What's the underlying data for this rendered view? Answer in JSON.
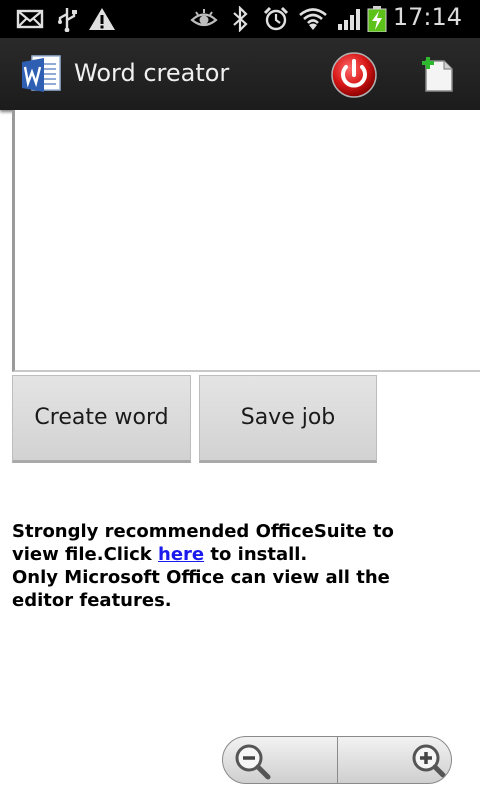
{
  "status_bar": {
    "time": "17:14",
    "icons": [
      "mail-icon",
      "usb-icon",
      "warning-icon",
      "eye-icon",
      "bluetooth-icon",
      "alarm-icon",
      "wifi-icon",
      "signal-icon",
      "battery-charging-icon"
    ]
  },
  "action_bar": {
    "title": "Word creator",
    "icons": [
      "word-app-icon",
      "power-icon",
      "new-document-icon"
    ]
  },
  "editor": {
    "value": ""
  },
  "buttons": {
    "create": "Create word",
    "save": "Save job"
  },
  "info": {
    "line1_prefix": "Strongly recommended OfficeSuite to view file.Click ",
    "link": "here",
    "line1_suffix": " to install.",
    "line2": "Only Microsoft Office can view all the editor features."
  },
  "zoom": {
    "icons": [
      "zoom-out-icon",
      "zoom-in-icon"
    ]
  },
  "colors": {
    "link": "#1a1aee",
    "power_red": "#d81818"
  }
}
